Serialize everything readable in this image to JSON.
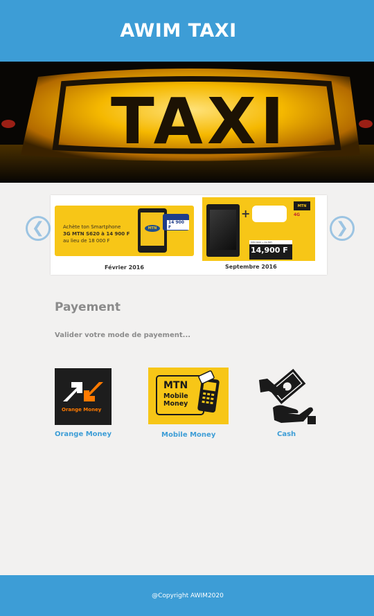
{
  "header": {
    "title": "AWIM TAXI"
  },
  "hero": {
    "sign_text": "TAXI"
  },
  "carousel": {
    "prev_icon": "chevron-left-icon",
    "next_icon": "chevron-right-icon",
    "prev_glyph": "❮",
    "next_glyph": "❯",
    "slides": [
      {
        "promo_line1": "Achète ton Smartphone",
        "promo_line2": "3G MTN S620 à 14 900 F",
        "promo_line3": "au lieu de 18 000 F",
        "phone_logo": "MTN",
        "price_tag": "14 900 F",
        "caption": "Février 2016"
      },
      {
        "mtn_badge": "MTN",
        "badge_4g": "4G",
        "price_small": "MTN S620 + 4G MIFI",
        "price_big": "14,900 F",
        "caption": "Septembre 2016"
      }
    ]
  },
  "payment": {
    "title": "Payement",
    "subtitle": "Valider votre mode de payement...",
    "options": [
      {
        "label": "Orange Money",
        "logo_text": "Orange Money",
        "icon": "orange-money-logo"
      },
      {
        "label": "Mobile Money",
        "logo_line1": "MTN",
        "logo_line2": "Mobile",
        "logo_line3": "Money",
        "icon": "mtn-mobile-money-logo"
      },
      {
        "label": "Cash",
        "icon": "cash-hand-icon"
      }
    ]
  },
  "footer": {
    "copyright": "@Copyright AWIM2020"
  },
  "colors": {
    "brand_blue": "#3d9dd6",
    "background": "#f2f1f0",
    "mtn_yellow": "#f7c617",
    "orange": "#ff7a00"
  }
}
